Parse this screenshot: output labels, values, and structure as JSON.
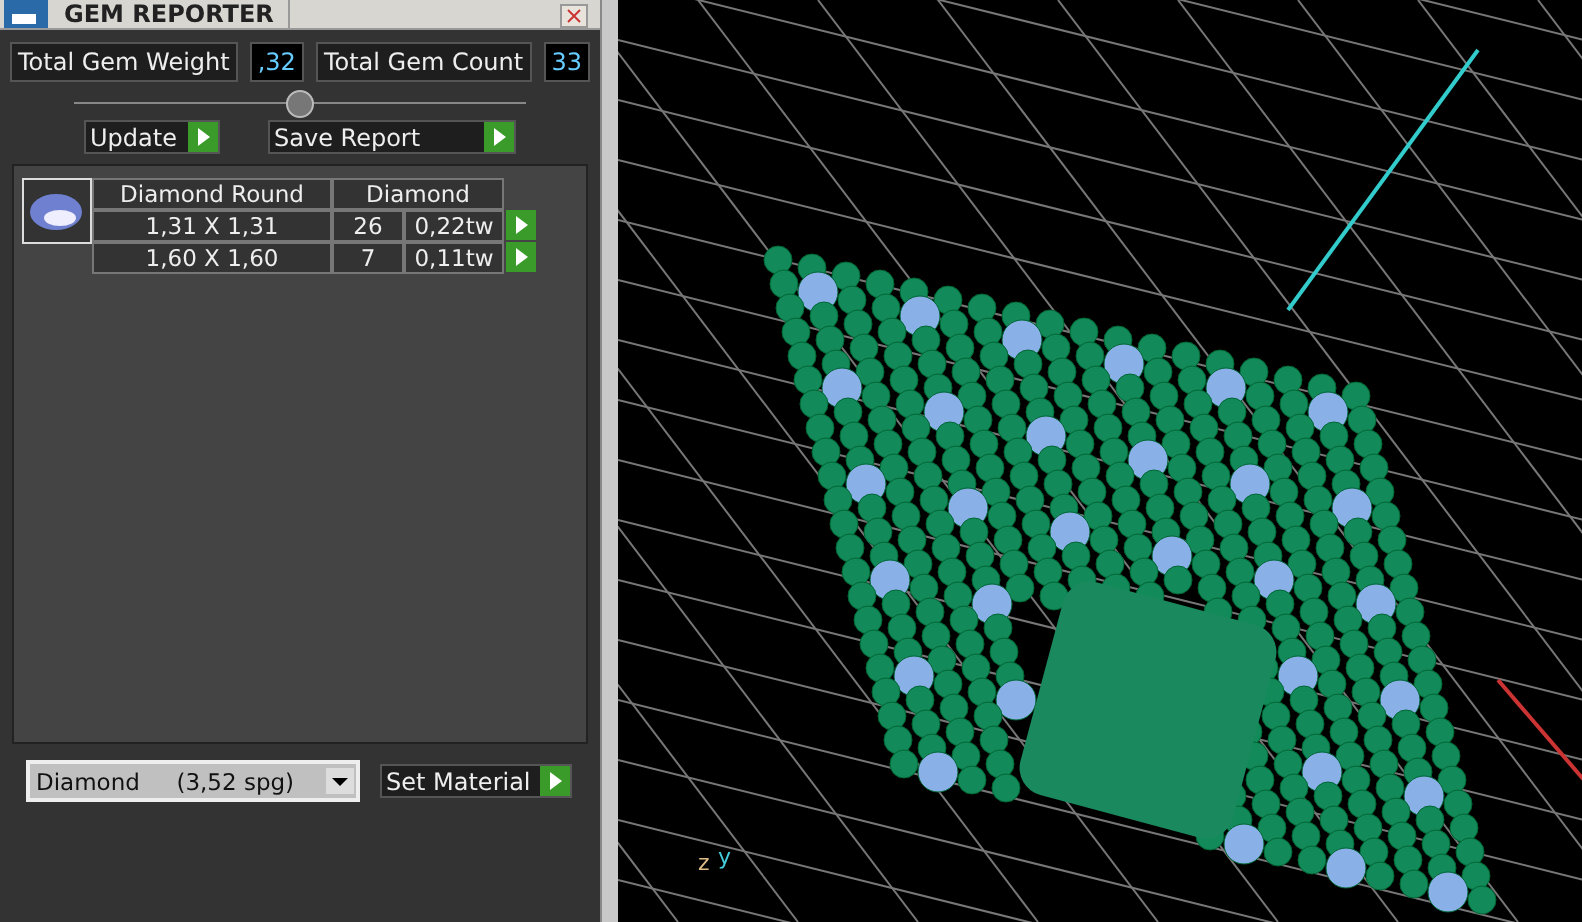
{
  "window": {
    "title": "GEM REPORTER"
  },
  "totals": [
    {
      "label": "Total Gem Weight",
      "value": ",32"
    },
    {
      "label": "Total Gem Count",
      "value": "33"
    }
  ],
  "actions": [
    "Update",
    "Save Report"
  ],
  "gem_table": {
    "shape": "Diamond Round",
    "material": "Diamond",
    "rows": [
      {
        "size": "1,31 X 1,31",
        "count": "26",
        "weight": "0,22tw"
      },
      {
        "size": "1,60 X 1,60",
        "count": "7",
        "weight": "0,11tw"
      }
    ]
  },
  "material_select": {
    "value": "Diamond     (3,52 spg)"
  },
  "set_material_button": "Set Material",
  "viewport": {
    "axis_labels": [
      "z",
      "y"
    ]
  }
}
